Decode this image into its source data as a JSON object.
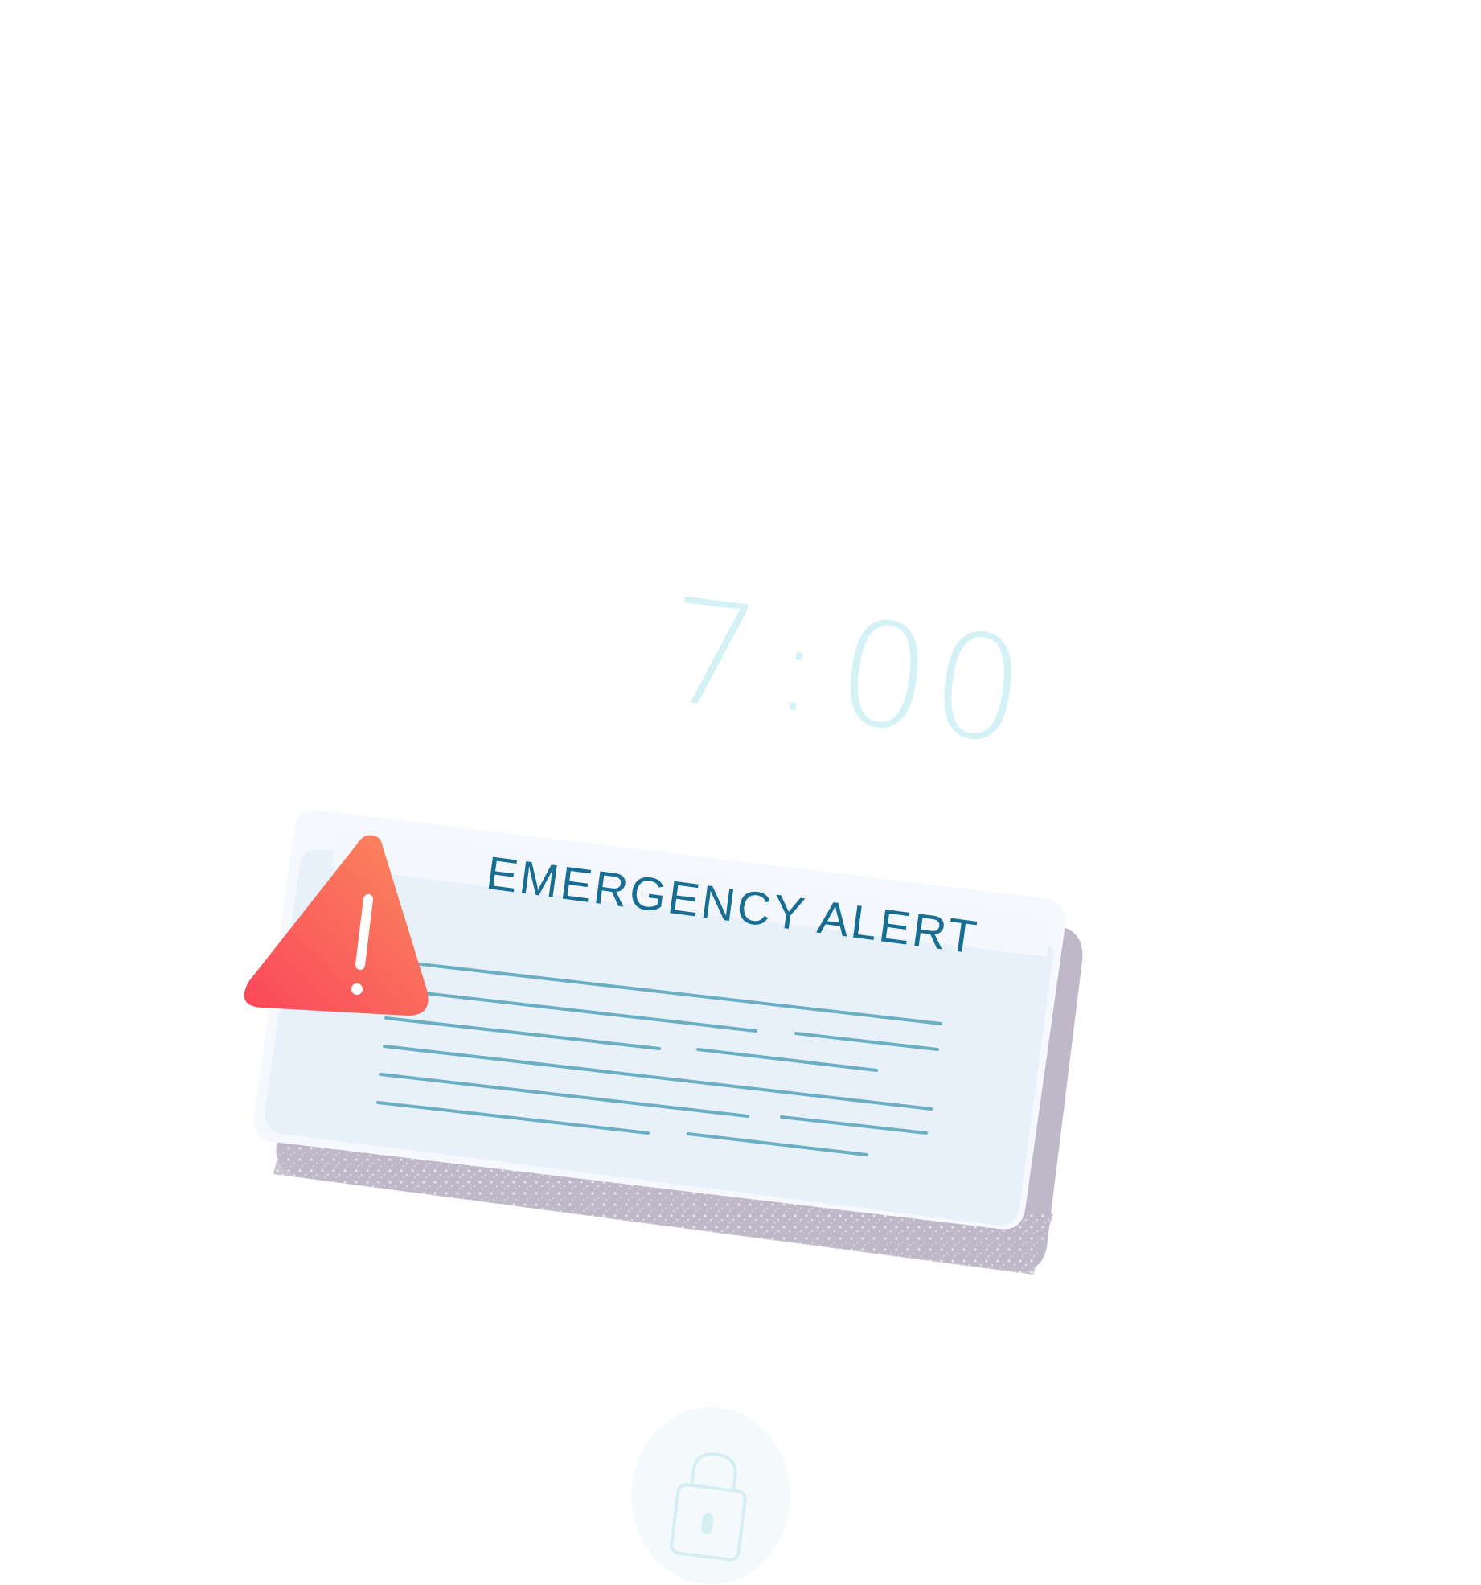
{
  "lockscreen": {
    "clock": {
      "hours": "7",
      "separator": ":",
      "minutes": "00"
    }
  },
  "alert": {
    "title": "EMERGENCY ALERT",
    "icon": "warning-triangle-icon",
    "colors": {
      "title": "#176d92",
      "card": "#e8f0f9",
      "shadow": "#bfb8c8",
      "text_lines": "#6aaec4",
      "icon_gradient_start": "#f9465a",
      "icon_gradient_end": "#fb8a5e"
    }
  },
  "unlock": {
    "icon": "padlock-icon",
    "color": "#d4eef2"
  }
}
